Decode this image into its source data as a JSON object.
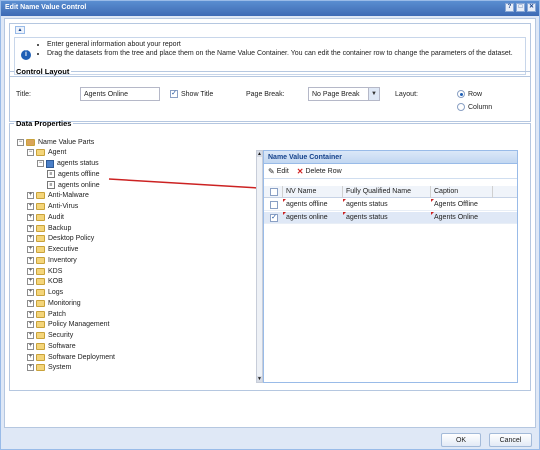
{
  "window": {
    "title": "Edit Name Value Control",
    "btns": [
      "?",
      "□",
      "✕"
    ]
  },
  "info": {
    "lines": [
      "Enter general information about your report",
      "Drag the datasets from the tree and place them on the Name Value Container. You can edit the container row to change the parameters of the dataset."
    ]
  },
  "control_layout": {
    "legend": "Control Layout",
    "title_label": "Title:",
    "title_value": "Agents Online",
    "show_title_label": "Show Title",
    "show_title_checked": true,
    "page_break_label": "Page Break:",
    "page_break_value": "No Page Break",
    "layout_label": "Layout:",
    "layout_row": "Row",
    "layout_column": "Column",
    "layout_selected": "Row"
  },
  "data_properties": {
    "legend": "Data Properties",
    "tree": [
      {
        "label": "Name Value Parts",
        "level": 0,
        "type": "root",
        "exp": "−"
      },
      {
        "label": "Agent",
        "level": 1,
        "type": "folder",
        "exp": "−"
      },
      {
        "label": "agents status",
        "level": 2,
        "type": "dataset",
        "exp": "−"
      },
      {
        "label": "agents offline",
        "level": 3,
        "type": "leaf"
      },
      {
        "label": "agents online",
        "level": 3,
        "type": "leaf"
      },
      {
        "label": "Anti-Malware",
        "level": 1,
        "type": "folder",
        "exp": "+"
      },
      {
        "label": "Anti-Virus",
        "level": 1,
        "type": "folder",
        "exp": "+"
      },
      {
        "label": "Audit",
        "level": 1,
        "type": "folder",
        "exp": "+"
      },
      {
        "label": "Backup",
        "level": 1,
        "type": "folder",
        "exp": "+"
      },
      {
        "label": "Desktop Policy",
        "level": 1,
        "type": "folder",
        "exp": "+"
      },
      {
        "label": "Executive",
        "level": 1,
        "type": "folder",
        "exp": "+"
      },
      {
        "label": "Inventory",
        "level": 1,
        "type": "folder",
        "exp": "+"
      },
      {
        "label": "KDS",
        "level": 1,
        "type": "folder",
        "exp": "+"
      },
      {
        "label": "KOB",
        "level": 1,
        "type": "folder",
        "exp": "+"
      },
      {
        "label": "Logs",
        "level": 1,
        "type": "folder",
        "exp": "+"
      },
      {
        "label": "Monitoring",
        "level": 1,
        "type": "folder",
        "exp": "+"
      },
      {
        "label": "Patch",
        "level": 1,
        "type": "folder",
        "exp": "+"
      },
      {
        "label": "Policy Management",
        "level": 1,
        "type": "folder",
        "exp": "+"
      },
      {
        "label": "Security",
        "level": 1,
        "type": "folder",
        "exp": "+"
      },
      {
        "label": "Software",
        "level": 1,
        "type": "folder",
        "exp": "+"
      },
      {
        "label": "Software Deployment",
        "level": 1,
        "type": "folder",
        "exp": "+"
      },
      {
        "label": "System",
        "level": 1,
        "type": "folder",
        "exp": "+"
      }
    ],
    "container": {
      "header": "Name Value Container",
      "edit_label": "Edit",
      "delete_label": "Delete Row",
      "columns": [
        "NV Name",
        "Fully Qualified Name",
        "Caption"
      ],
      "rows": [
        {
          "checked": false,
          "nv_name": "agents offline",
          "fqn": "agents status",
          "caption": "Agents Offline"
        },
        {
          "checked": true,
          "nv_name": "agents online",
          "fqn": "agents status",
          "caption": "Agents Online"
        }
      ]
    }
  },
  "footer": {
    "ok": "OK",
    "cancel": "Cancel"
  },
  "colors": {
    "titlebar": "#3d6ab4",
    "accent": "#15428b",
    "arrow": "#cc2222"
  }
}
